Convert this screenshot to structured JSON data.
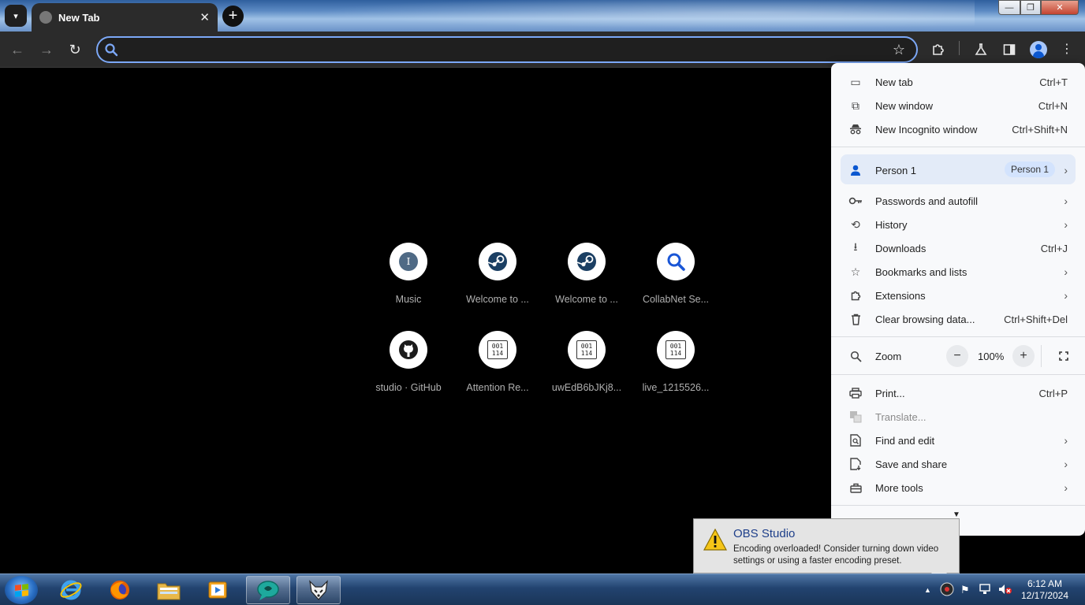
{
  "window": {
    "tab_title": "New Tab",
    "controls": {
      "minimize": "—",
      "maximize": "❐",
      "close": "✕"
    }
  },
  "toolbar": {
    "back_icon": "arrow-left-icon",
    "forward_icon": "arrow-right-icon",
    "reload_icon": "reload-icon",
    "omnibox_value": "",
    "omnibox_placeholder": ""
  },
  "shortcuts": [
    {
      "label": "Music",
      "icon": "letter-I",
      "letter": "I"
    },
    {
      "label": "Welcome to ...",
      "icon": "steam-icon"
    },
    {
      "label": "Welcome to ...",
      "icon": "steam-icon"
    },
    {
      "label": "CollabNet Se...",
      "icon": "search-icon"
    },
    {
      "label": "studio · GitHub",
      "icon": "github-icon"
    },
    {
      "label": "Attention Re...",
      "icon": "binary-file-icon",
      "glyph": "001\n114"
    },
    {
      "label": "uwEdB6bJKj8...",
      "icon": "binary-file-icon",
      "glyph": "001\n114"
    },
    {
      "label": "live_1215526...",
      "icon": "binary-file-icon",
      "glyph": "001\n114"
    }
  ],
  "menu": {
    "new_tab": {
      "label": "New tab",
      "shortcut": "Ctrl+T"
    },
    "new_window": {
      "label": "New window",
      "shortcut": "Ctrl+N"
    },
    "new_incognito": {
      "label": "New Incognito window",
      "shortcut": "Ctrl+Shift+N"
    },
    "person": {
      "label": "Person 1",
      "pill": "Person 1"
    },
    "passwords": {
      "label": "Passwords and autofill"
    },
    "history": {
      "label": "History"
    },
    "downloads": {
      "label": "Downloads",
      "shortcut": "Ctrl+J"
    },
    "bookmarks": {
      "label": "Bookmarks and lists"
    },
    "extensions": {
      "label": "Extensions"
    },
    "clear_data": {
      "label": "Clear browsing data...",
      "shortcut": "Ctrl+Shift+Del"
    },
    "zoom": {
      "label": "Zoom",
      "minus": "−",
      "value": "100%",
      "plus": "+"
    },
    "print": {
      "label": "Print...",
      "shortcut": "Ctrl+P"
    },
    "translate": {
      "label": "Translate..."
    },
    "find_edit": {
      "label": "Find and edit"
    },
    "save_share": {
      "label": "Save and share"
    },
    "more_tools": {
      "label": "More tools"
    }
  },
  "notification": {
    "title": "OBS Studio",
    "message": "Encoding overloaded! Consider turning down video settings or using a faster encoding preset."
  },
  "taskbar": {
    "apps": [
      "internet-explorer-icon",
      "firefox-icon",
      "file-explorer-icon",
      "media-player-icon",
      "chat-app-icon",
      "fox-app-icon"
    ],
    "time": "6:12 AM",
    "date": "12/17/2024"
  },
  "colors": {
    "menu_bg": "#f8f9fb",
    "person_highlight": "#e3ebf8",
    "omnibox_focus": "#7ca8f7",
    "notification_title": "#1e3f8a"
  }
}
